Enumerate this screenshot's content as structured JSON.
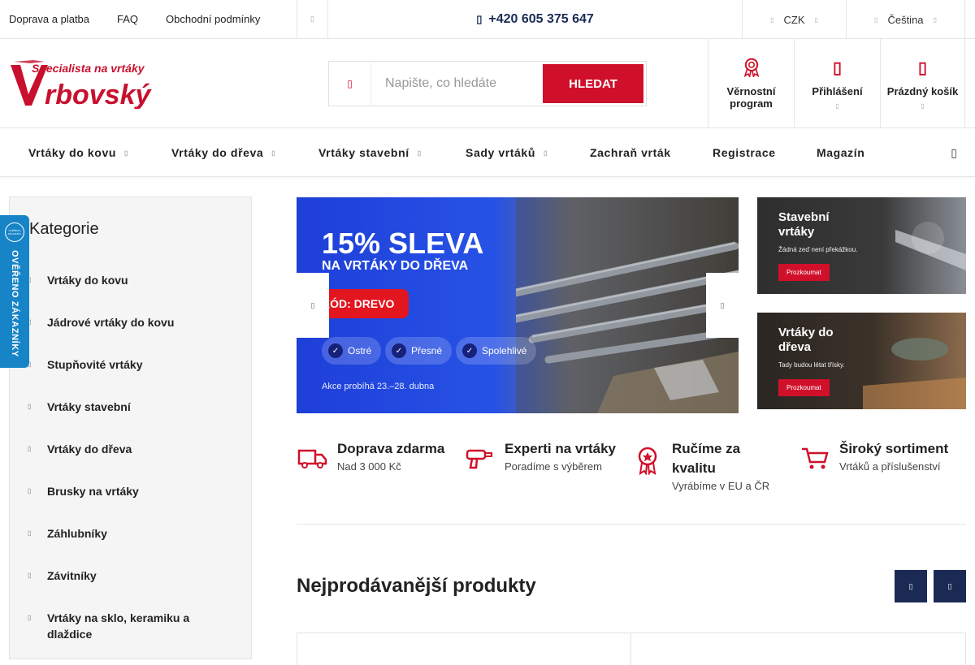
{
  "topbar": {
    "links": [
      "Doprava a platba",
      "FAQ",
      "Obchodní podmínky"
    ],
    "phone_icon": "phone-icon",
    "phone": "+420 605 375 647",
    "currency": "CZK",
    "language": "Čeština",
    "glyph": "▯"
  },
  "header": {
    "logo_tagline": "Specialista na vrtáky",
    "logo_brand": "rbovský",
    "logo_initial": "V",
    "search_placeholder": "Napište, co hledáte",
    "search_button": "HLEDAT",
    "loyalty": "Věrnostní program",
    "login": "Přihlášení",
    "cart": "Prázdný košík"
  },
  "nav": {
    "items": [
      "Vrtáky do kovu",
      "Vrtáky do dřeva",
      "Vrtáky stavební",
      "Sady vrtáků",
      "Zachraň vrták",
      "Registrace",
      "Magazín"
    ]
  },
  "sidebar": {
    "title": "Kategorie",
    "categories": [
      "Vrtáky do kovu",
      "Jádrové vrtáky do kovu",
      "Stupňovité vrtáky",
      "Vrtáky stavební",
      "Vrtáky do dřeva",
      "Brusky na vrtáky",
      "Záhlubníky",
      "Závitníky",
      "Vrtáky na sklo, keramiku a dlaždice"
    ],
    "badge_text": "OVĚŘENO ZÁKAZNÍKY",
    "badge_small": "OVĚŘENO ZÁKAZNÍKY"
  },
  "slider": {
    "headline": "15% SLEVA",
    "subline": "NA VRTÁKY DO DŘEVA",
    "code": "KÓD: DREVO",
    "pills": [
      "Ostré",
      "Přesné",
      "Spolehlivé"
    ],
    "note": "Akce probíhá 23.–28. dubna"
  },
  "banners": [
    {
      "title": "Stavební vrtáky",
      "subtitle": "Žádná zeď není překážkou.",
      "button": "Prozkoumat"
    },
    {
      "title": "Vrtáky do dřeva",
      "subtitle": "Tady budou létat třísky.",
      "button": "Prozkoumat"
    }
  ],
  "usps": [
    {
      "icon": "truck-icon",
      "title": "Doprava zdarma",
      "desc": "Nad 3 000 Kč"
    },
    {
      "icon": "drill-icon",
      "title": "Experti na vrtáky",
      "desc": "Poradíme s výběrem"
    },
    {
      "icon": "award-icon",
      "title": "Ručíme za kvalitu",
      "desc": "Vyrábíme v EU a ČR"
    },
    {
      "icon": "cart-icon",
      "title": "Široký sortiment",
      "desc": "Vrtáků a příslušenství"
    }
  ],
  "bestsellers": {
    "title": "Nejprodávanější produkty"
  },
  "colors": {
    "accent": "#d0102a",
    "navy": "#1b2a55",
    "badge": "#1784c7"
  }
}
